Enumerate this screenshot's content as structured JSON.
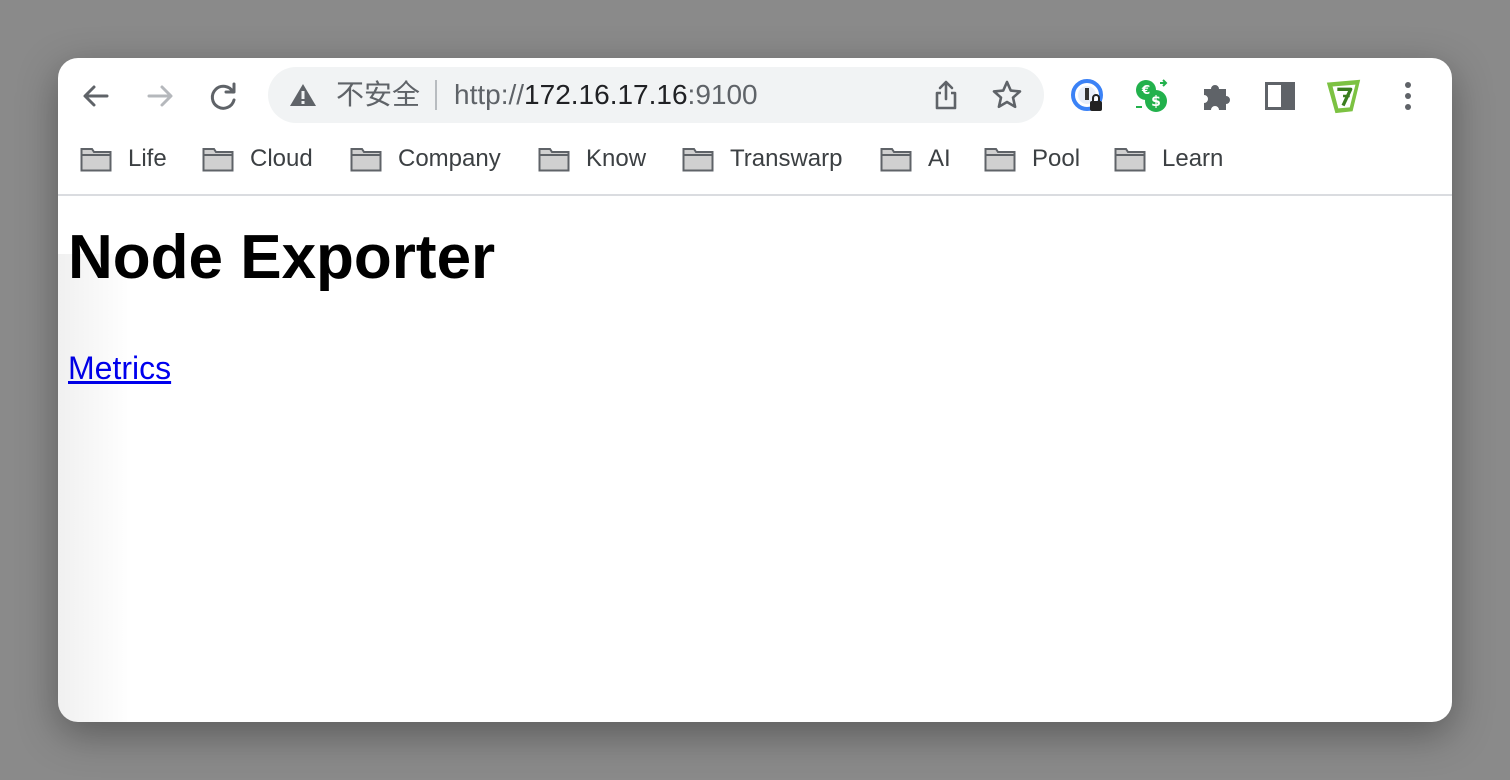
{
  "browser": {
    "address_bar": {
      "security_label": "不安全",
      "url_scheme": "http://",
      "url_host": "172.16.17.16",
      "url_port": ":9100"
    },
    "nav": {
      "back_icon": "arrow-left",
      "forward_icon": "arrow-right",
      "reload_icon": "reload"
    },
    "extensions": [
      "password-lock-icon",
      "currency-converter-icon",
      "puzzle-icon",
      "side-panel-icon",
      "profile-badge-icon",
      "more-vert-icon"
    ]
  },
  "bookmarks": [
    {
      "label": "Life"
    },
    {
      "label": "Cloud"
    },
    {
      "label": "Company"
    },
    {
      "label": "Know"
    },
    {
      "label": "Transwarp"
    },
    {
      "label": "AI"
    },
    {
      "label": "Pool"
    },
    {
      "label": "Learn"
    }
  ],
  "page": {
    "title": "Node Exporter",
    "link_label": "Metrics"
  },
  "colors": {
    "link": "#0000ee",
    "omnibox_bg": "#f1f3f4",
    "accent_green": "#22b14c"
  }
}
